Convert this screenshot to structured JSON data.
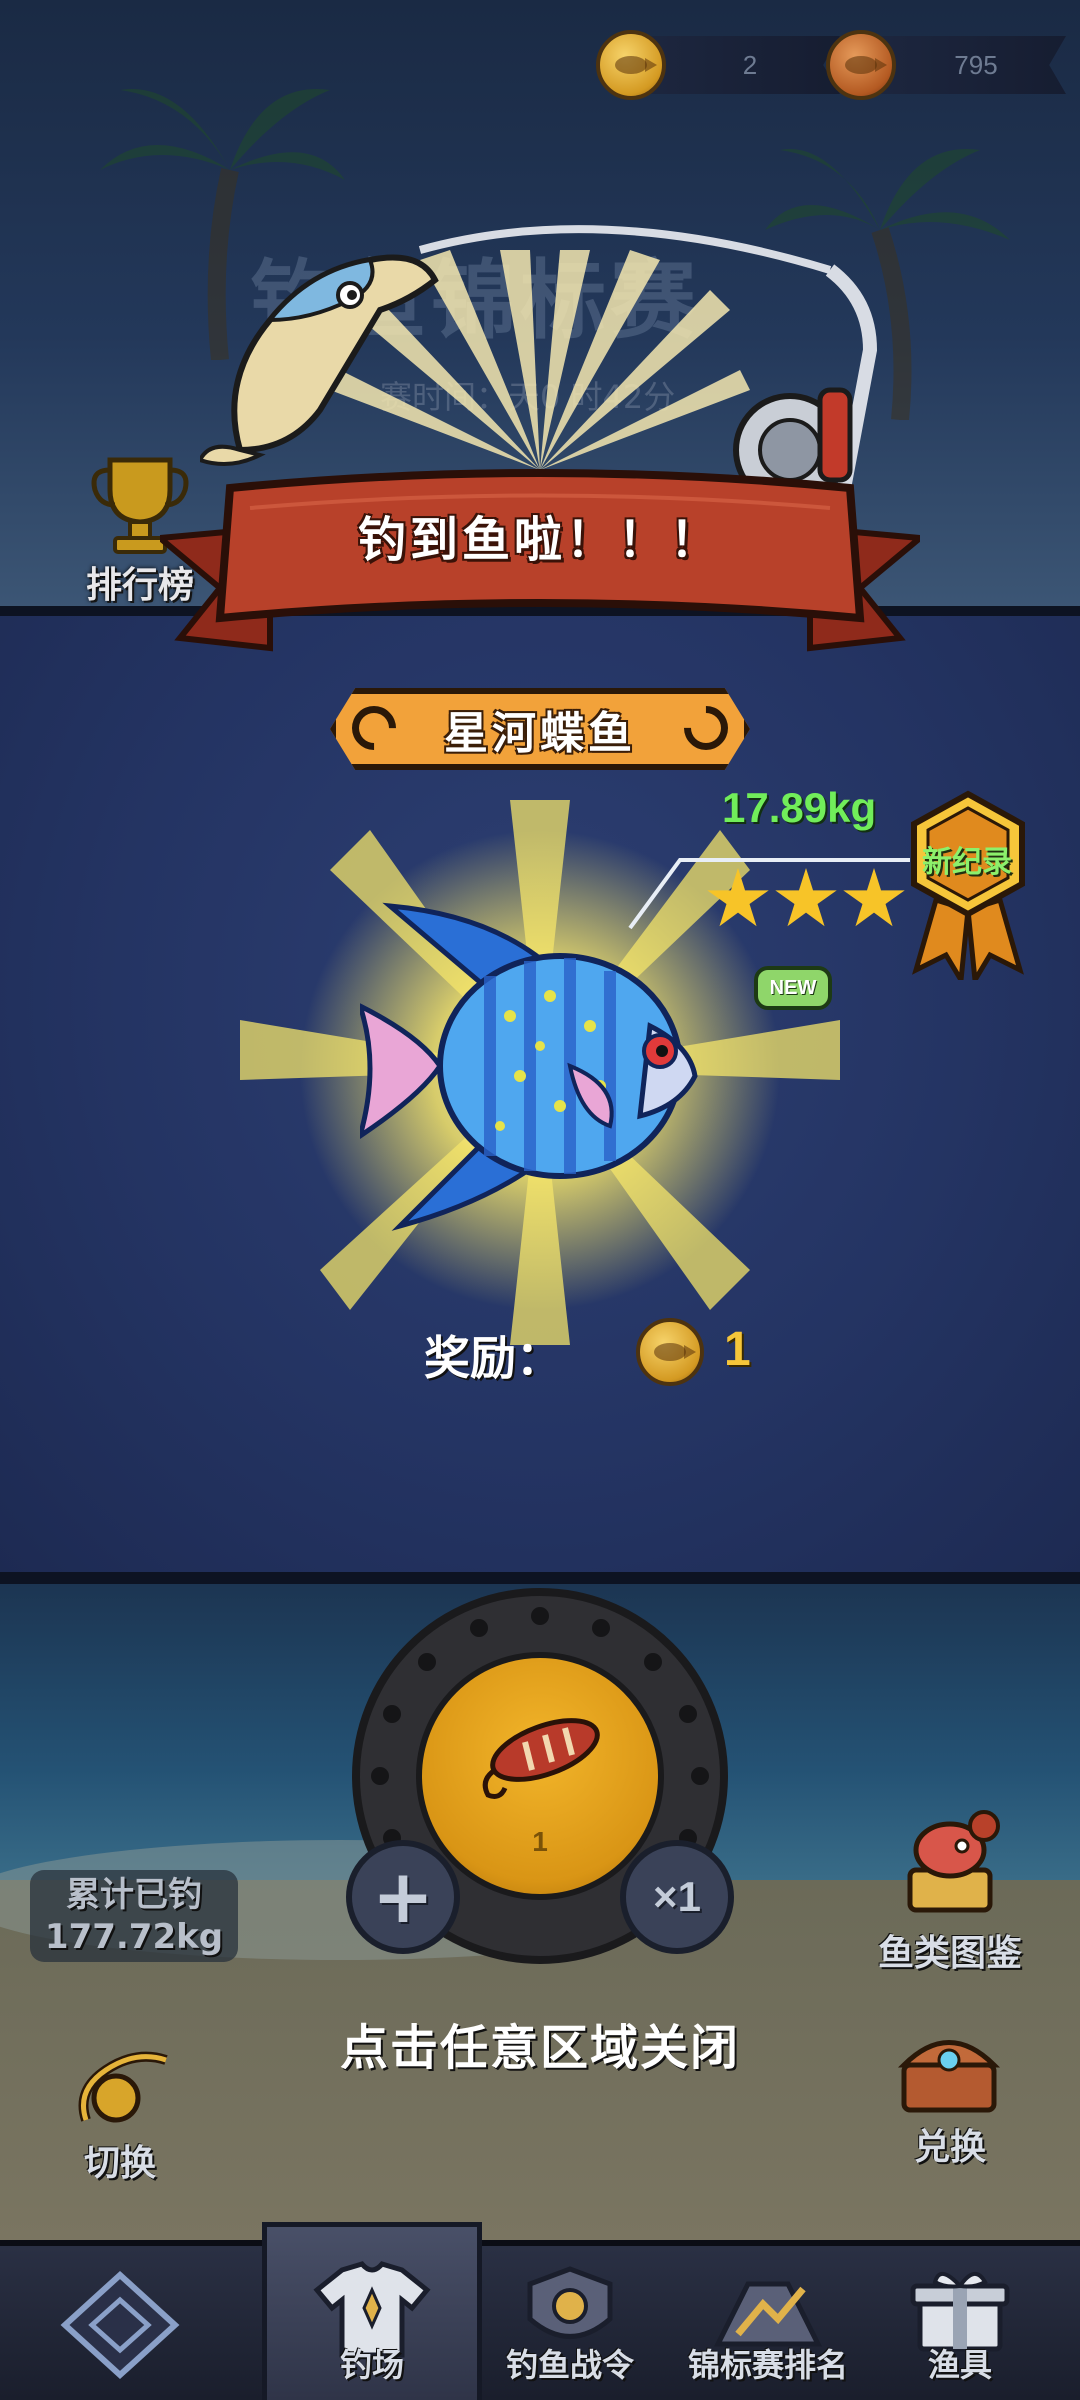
{
  "currency": {
    "gold_count": "2",
    "bronze_count": "795",
    "gold_icon": "gold-fish-coin-icon",
    "bronze_icon": "bronze-fish-coin-icon"
  },
  "background": {
    "title": "钓鱼锦标赛",
    "subtitle": "赛时间：天0 时42分"
  },
  "leaderboard": {
    "label": "排行榜",
    "icon": "trophy-icon"
  },
  "result": {
    "banner_text": "钓到鱼啦！！！",
    "fish_name": "星河蝶鱼",
    "weight": "17.89kg",
    "stars": 3,
    "record_label": "新纪录",
    "new_tag": "NEW",
    "reward_label": "奖励：",
    "reward_count": "1",
    "reward_icon": "gold-fish-coin-icon"
  },
  "bait": {
    "count": "1",
    "multiplier": "×1",
    "icon": "fishing-lure-icon"
  },
  "stats": {
    "line1": "累计已钓",
    "line2": "177.72kg"
  },
  "side_buttons": {
    "switch": "切换",
    "encyclopedia": "鱼类图鉴",
    "exchange": "兑换"
  },
  "close_hint": "点击任意区域关闭",
  "nav": {
    "items": [
      {
        "label": "",
        "icon": "back-diamond-icon"
      },
      {
        "label": "钓场",
        "icon": "shirt-icon",
        "active": true
      },
      {
        "label": "钓鱼战令",
        "icon": "crest-icon"
      },
      {
        "label": "锦标赛排名",
        "icon": "ranking-icon"
      },
      {
        "label": "渔具",
        "icon": "gift-box-icon"
      }
    ]
  },
  "colors": {
    "banner_red": "#b8412a",
    "plate_orange": "#f2a23a",
    "weight_green": "#71ee5a",
    "star_gold": "#f7c428",
    "coin_gold": "#f6c63a"
  }
}
